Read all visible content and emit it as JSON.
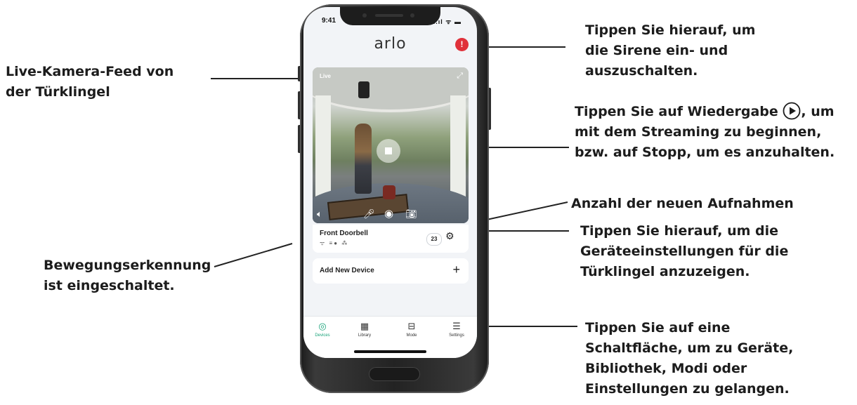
{
  "phone": {
    "status_time": "9:41",
    "status_icons": "..ıl ᯤ ▬",
    "app_logo": "arlo",
    "siren_icon": "siren-icon",
    "feed": {
      "live_label": "Live"
    },
    "device": {
      "name": "Front Doorbell",
      "status_icons": "ᯤ ≡● ⁂",
      "recordings_count": "23"
    },
    "add_device_label": "Add New Device",
    "tabs": [
      {
        "label": "Devices",
        "active": true
      },
      {
        "label": "Library",
        "active": false
      },
      {
        "label": "Mode",
        "active": false
      },
      {
        "label": "Settings",
        "active": false
      }
    ],
    "colors": {
      "accent": "#1aa37a",
      "siren": "#e0313a"
    }
  },
  "callouts": {
    "live_feed": [
      "Live-Kamera-Feed von",
      "der Türklingel"
    ],
    "motion": [
      "Bewegungserkennung",
      "ist eingeschaltet."
    ],
    "siren": [
      "Tippen Sie hierauf, um",
      "die Sirene ein- und",
      "auszuschalten."
    ],
    "play": [
      "Tippen Sie auf Wiedergabe",
      ", um",
      "mit dem Streaming zu beginnen,",
      "bzw. auf Stopp, um es anzuhalten."
    ],
    "recordings": [
      "Anzahl der neuen Aufnahmen"
    ],
    "settings_device": [
      "Tippen Sie hierauf, um die",
      "Geräteeinstellungen für die",
      "Türklingel anzuzeigen."
    ],
    "tabs": [
      "Tippen Sie auf eine",
      "Schaltfläche, um zu Geräte,",
      "Bibliothek, Modi oder",
      "Einstellungen zu gelangen."
    ]
  }
}
